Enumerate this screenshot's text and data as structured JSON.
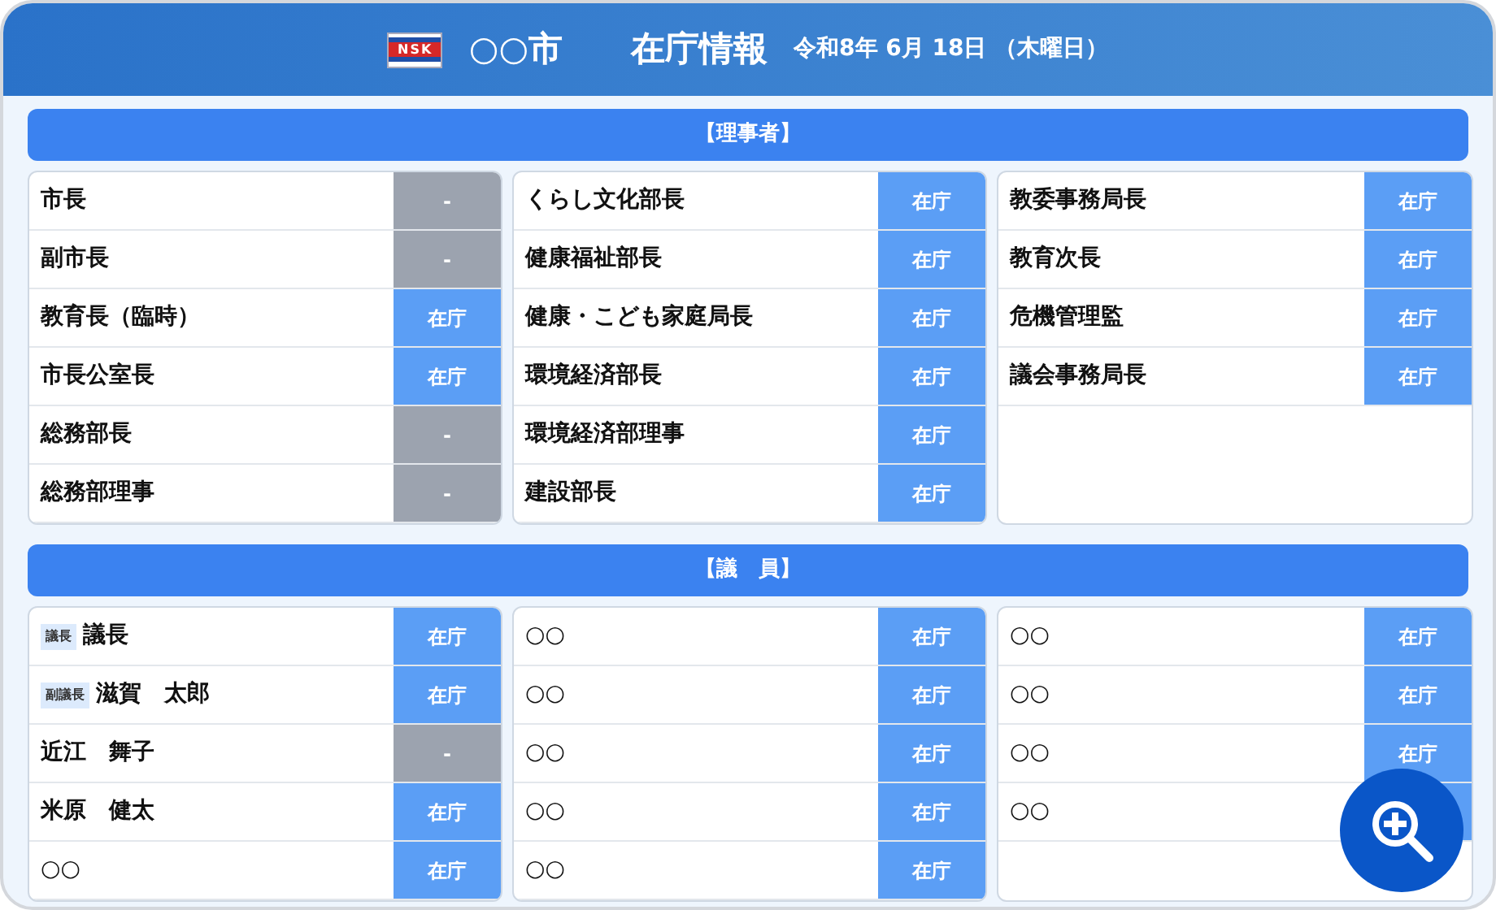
{
  "header": {
    "logo": "NSK",
    "city": "○○市",
    "title": "在庁情報",
    "date": "令和8年 6月 18日 （木曜日）"
  },
  "sections": [
    {
      "heading": "【理事者】",
      "columns": [
        [
          {
            "name": "市長",
            "present": false,
            "label": "-"
          },
          {
            "name": "副市長",
            "present": false,
            "label": "-"
          },
          {
            "name": "教育長（臨時）",
            "present": true,
            "label": "在庁"
          },
          {
            "name": "市長公室長",
            "present": true,
            "label": "在庁"
          },
          {
            "name": "総務部長",
            "present": false,
            "label": "-"
          },
          {
            "name": "総務部理事",
            "present": false,
            "label": "-"
          }
        ],
        [
          {
            "name": "くらし文化部長",
            "present": true,
            "label": "在庁"
          },
          {
            "name": "健康福祉部長",
            "present": true,
            "label": "在庁"
          },
          {
            "name": "健康・こども家庭局長",
            "present": true,
            "label": "在庁"
          },
          {
            "name": "環境経済部長",
            "present": true,
            "label": "在庁"
          },
          {
            "name": "環境経済部理事",
            "present": true,
            "label": "在庁"
          },
          {
            "name": "建設部長",
            "present": true,
            "label": "在庁"
          }
        ],
        [
          {
            "name": "教委事務局長",
            "present": true,
            "label": "在庁"
          },
          {
            "name": "教育次長",
            "present": true,
            "label": "在庁"
          },
          {
            "name": "危機管理監",
            "present": true,
            "label": "在庁"
          },
          {
            "name": "議会事務局長",
            "present": true,
            "label": "在庁"
          }
        ]
      ]
    },
    {
      "heading": "【議　員】",
      "columns": [
        [
          {
            "name": "議長",
            "tag": "議長",
            "present": true,
            "label": "在庁"
          },
          {
            "name": "滋賀　太郎",
            "tag": "副議長",
            "present": true,
            "label": "在庁"
          },
          {
            "name": "近江　舞子",
            "present": false,
            "label": "-"
          },
          {
            "name": "米原　健太",
            "present": true,
            "label": "在庁"
          },
          {
            "name": "○○",
            "present": true,
            "label": "在庁"
          }
        ],
        [
          {
            "name": "○○",
            "present": true,
            "label": "在庁"
          },
          {
            "name": "○○",
            "present": true,
            "label": "在庁"
          },
          {
            "name": "○○",
            "present": true,
            "label": "在庁"
          },
          {
            "name": "○○",
            "present": true,
            "label": "在庁"
          },
          {
            "name": "○○",
            "present": true,
            "label": "在庁"
          }
        ],
        [
          {
            "name": "○○",
            "present": true,
            "label": "在庁"
          },
          {
            "name": "○○",
            "present": true,
            "label": "在庁"
          },
          {
            "name": "○○",
            "present": true,
            "label": "在庁"
          },
          {
            "name": "○○",
            "present": true
          }
        ]
      ]
    }
  ]
}
